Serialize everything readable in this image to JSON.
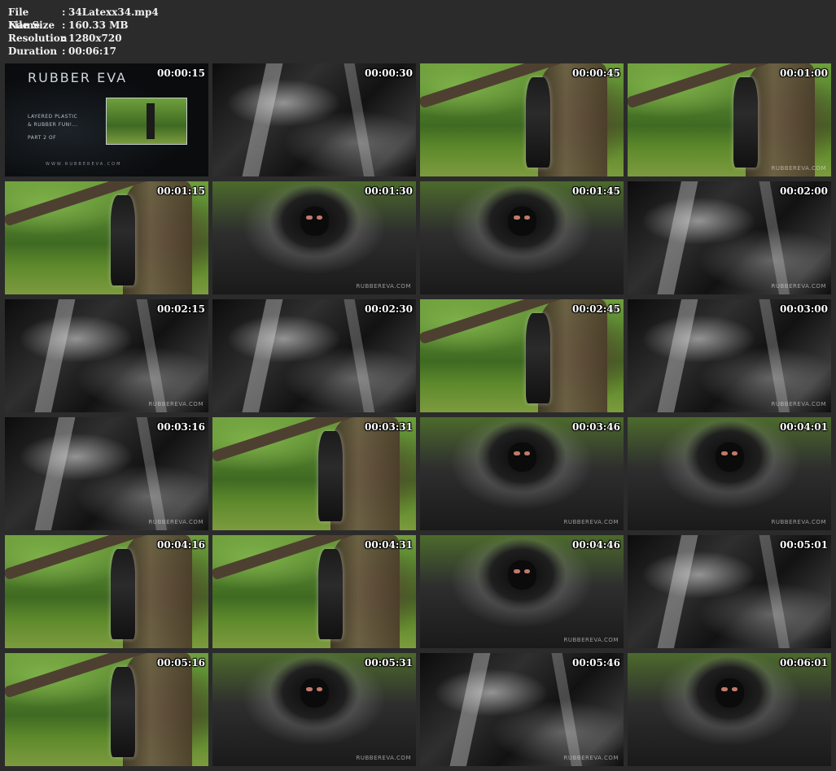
{
  "file_info": {
    "file_name_label": "File Name",
    "file_name_value": "34Latexx34.mp4",
    "file_size_label": "File Size",
    "file_size_value": "160.33 MB",
    "resolution_label": "Resolution",
    "resolution_value": "1280x720",
    "duration_label": "Duration",
    "duration_value": "00:06:17",
    "separator": ":"
  },
  "title_card": {
    "brand": "RUBBER EVA",
    "subtitle_1": "LAYERED PLASTIC",
    "subtitle_2": "& RUBBER FUN!...",
    "subtitle_3": "PART 2 OF",
    "url": "WWW.RUBBEREVA.COM"
  },
  "watermark_text": "RUBBEREVA.COM",
  "thumbnails": [
    {
      "time": "00:00:15",
      "scene": "title",
      "watermark": ""
    },
    {
      "time": "00:00:30",
      "scene": "closeup",
      "watermark": ""
    },
    {
      "time": "00:00:45",
      "scene": "outdoor",
      "watermark": ""
    },
    {
      "time": "00:01:00",
      "scene": "outdoor",
      "watermark": "RUBBEREVA.COM"
    },
    {
      "time": "00:01:15",
      "scene": "outdoor",
      "watermark": ""
    },
    {
      "time": "00:01:30",
      "scene": "hood",
      "watermark": "RUBBEREVA.COM"
    },
    {
      "time": "00:01:45",
      "scene": "hood",
      "watermark": ""
    },
    {
      "time": "00:02:00",
      "scene": "closeup",
      "watermark": "RUBBEREVA.COM"
    },
    {
      "time": "00:02:15",
      "scene": "closeup",
      "watermark": "RUBBEREVA.COM"
    },
    {
      "time": "00:02:30",
      "scene": "closeup",
      "watermark": ""
    },
    {
      "time": "00:02:45",
      "scene": "outdoor",
      "watermark": ""
    },
    {
      "time": "00:03:00",
      "scene": "closeup",
      "watermark": "RUBBEREVA.COM"
    },
    {
      "time": "00:03:16",
      "scene": "closeup",
      "watermark": "RUBBEREVA.COM"
    },
    {
      "time": "00:03:31",
      "scene": "outdoor",
      "watermark": ""
    },
    {
      "time": "00:03:46",
      "scene": "hood",
      "watermark": "RUBBEREVA.COM"
    },
    {
      "time": "00:04:01",
      "scene": "hood",
      "watermark": "RUBBEREVA.COM"
    },
    {
      "time": "00:04:16",
      "scene": "outdoor",
      "watermark": ""
    },
    {
      "time": "00:04:31",
      "scene": "outdoor",
      "watermark": ""
    },
    {
      "time": "00:04:46",
      "scene": "hood",
      "watermark": "RUBBEREVA.COM"
    },
    {
      "time": "00:05:01",
      "scene": "closeup",
      "watermark": ""
    },
    {
      "time": "00:05:16",
      "scene": "outdoor",
      "watermark": ""
    },
    {
      "time": "00:05:31",
      "scene": "hood",
      "watermark": "RUBBEREVA.COM"
    },
    {
      "time": "00:05:46",
      "scene": "closeup",
      "watermark": "RUBBEREVA.COM"
    },
    {
      "time": "00:06:01",
      "scene": "hood",
      "watermark": ""
    }
  ]
}
